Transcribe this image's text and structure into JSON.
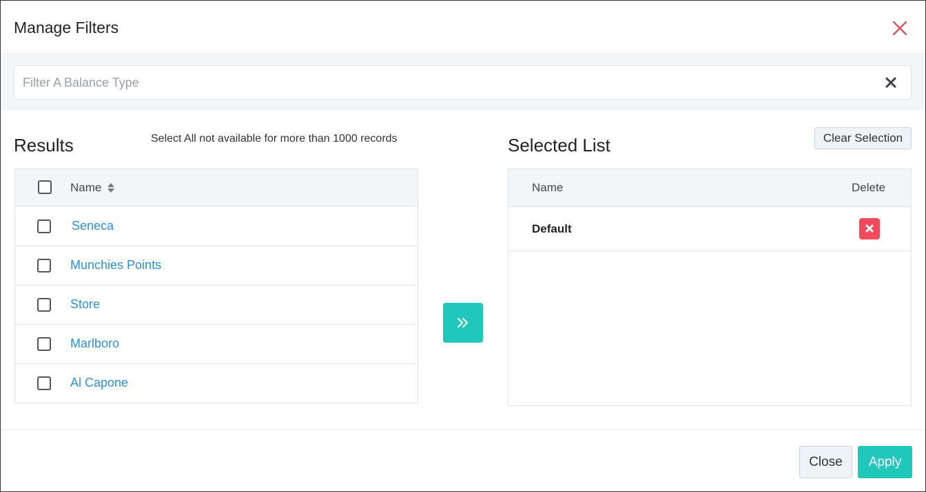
{
  "modal": {
    "title": "Manage Filters",
    "close_icon": "close-icon"
  },
  "filter": {
    "placeholder": "Filter A Balance Type",
    "value": "",
    "clear_icon": "clear-icon"
  },
  "results": {
    "title": "Results",
    "note": "Select All not available for more than 1000 records",
    "column_name": "Name",
    "rows": [
      {
        "label": "Seneca"
      },
      {
        "label": "Munchies Points"
      },
      {
        "label": "Store"
      },
      {
        "label": "Marlboro"
      },
      {
        "label": "Al Capone"
      }
    ]
  },
  "move_button_icon": "double-chevron-right-icon",
  "selected": {
    "title": "Selected List",
    "clear_label": "Clear Selection",
    "column_name": "Name",
    "column_delete": "Delete",
    "rows": [
      {
        "label": "Default"
      }
    ]
  },
  "footer": {
    "close_label": "Close",
    "apply_label": "Apply"
  },
  "colors": {
    "accent": "#1fc8bb",
    "link": "#2d8fe0",
    "danger": "#f2495d",
    "close_icon": "#e0515e"
  }
}
